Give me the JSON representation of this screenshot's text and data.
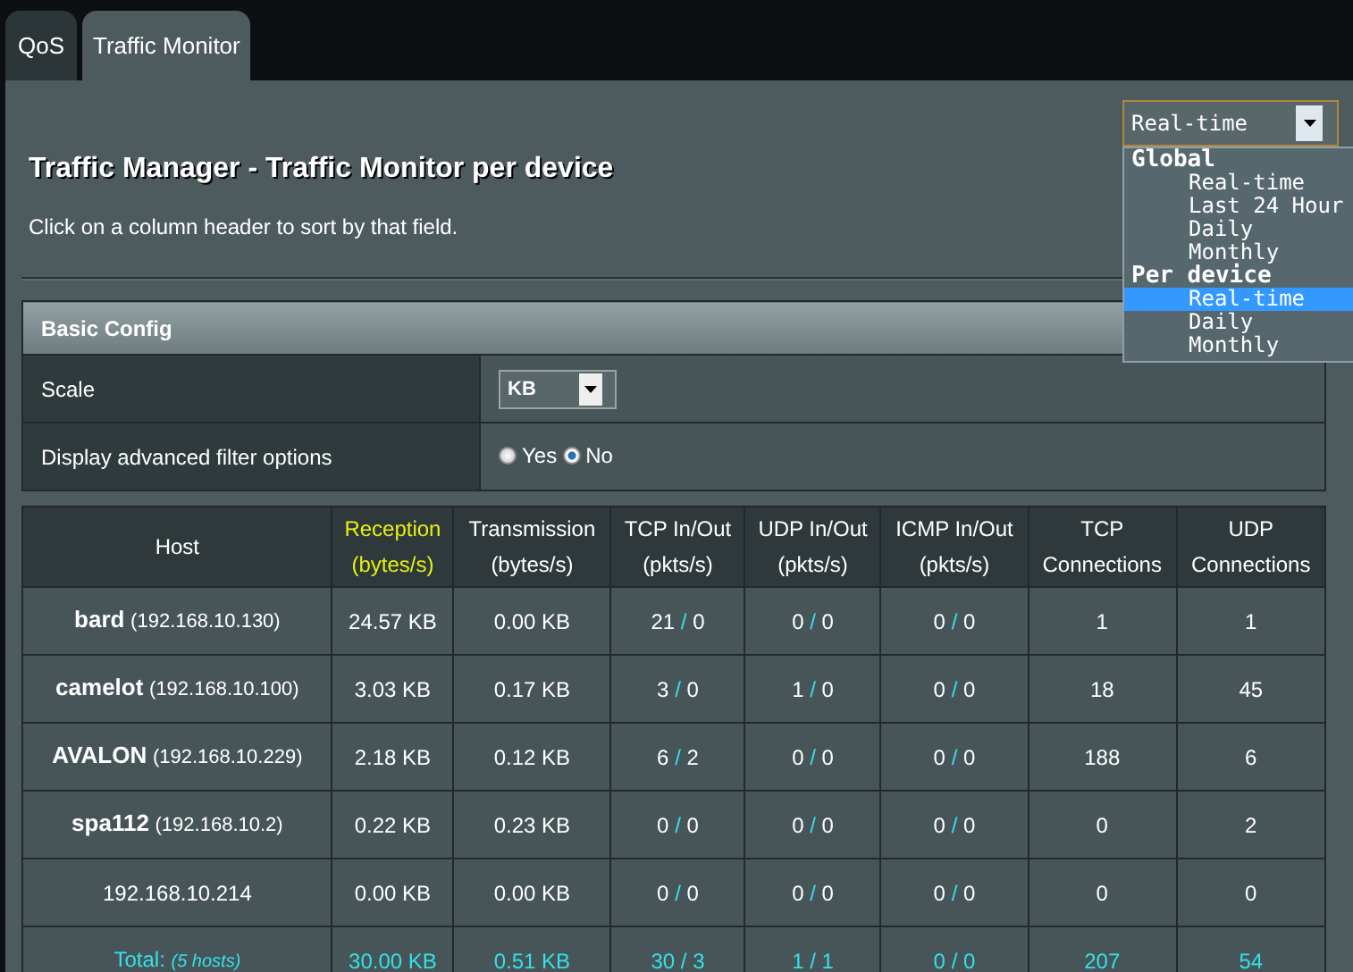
{
  "tabs": [
    {
      "label": "QoS",
      "selected": false
    },
    {
      "label": "Traffic Monitor",
      "selected": true
    }
  ],
  "title": "Traffic Manager - Traffic Monitor per device",
  "hint": "Click on a column header to sort by that field.",
  "view_select": {
    "value": "Real-time",
    "expanded": true,
    "groups": [
      {
        "label": "Global",
        "options": [
          {
            "label": "Real-time",
            "selected": false
          },
          {
            "label": "Last 24 Hour",
            "selected": false
          },
          {
            "label": "Daily",
            "selected": false
          },
          {
            "label": "Monthly",
            "selected": false
          }
        ]
      },
      {
        "label": "Per device",
        "options": [
          {
            "label": "Real-time",
            "selected": true
          },
          {
            "label": "Daily",
            "selected": false
          },
          {
            "label": "Monthly",
            "selected": false
          }
        ]
      }
    ]
  },
  "basic_config": {
    "title": "Basic Config",
    "scale": {
      "label": "Scale",
      "value": "KB"
    },
    "advanced_filter": {
      "label": "Display advanced filter options",
      "options": [
        {
          "label": "Yes",
          "selected": false
        },
        {
          "label": "No",
          "selected": true
        }
      ]
    }
  },
  "table": {
    "columns": [
      {
        "label": "Host",
        "selected": false
      },
      {
        "label": "Reception",
        "unit": "(bytes/s)",
        "selected": true
      },
      {
        "label": "Transmission",
        "unit": "(bytes/s)",
        "selected": false
      },
      {
        "label": "TCP In/Out",
        "unit": "(pkts/s)",
        "selected": false
      },
      {
        "label": "UDP In/Out",
        "unit": "(pkts/s)",
        "selected": false
      },
      {
        "label": "ICMP In/Out",
        "unit": "(pkts/s)",
        "selected": false
      },
      {
        "label": "TCP",
        "unit": "Connections",
        "selected": false
      },
      {
        "label": "UDP",
        "unit": "Connections",
        "selected": false
      }
    ],
    "rows": [
      {
        "host": {
          "name": "bard",
          "ip": "(192.168.10.130)"
        },
        "reception": "24.57 KB",
        "transmission": "0.00 KB",
        "tcp": [
          "21",
          "/",
          "0"
        ],
        "udp": [
          "0",
          "/",
          "0"
        ],
        "icmp": [
          "0",
          "/",
          "0"
        ],
        "tcp_connections": "1",
        "udp_connections": "1"
      },
      {
        "host": {
          "name": "camelot",
          "ip": "(192.168.10.100)"
        },
        "reception": "3.03 KB",
        "transmission": "0.17 KB",
        "tcp": [
          "3",
          "/",
          "0"
        ],
        "udp": [
          "1",
          "/",
          "0"
        ],
        "icmp": [
          "0",
          "/",
          "0"
        ],
        "tcp_connections": "18",
        "udp_connections": "45"
      },
      {
        "host": {
          "name": "AVALON",
          "ip": "(192.168.10.229)"
        },
        "reception": "2.18 KB",
        "transmission": "0.12 KB",
        "tcp": [
          "6",
          "/",
          "2"
        ],
        "udp": [
          "0",
          "/",
          "0"
        ],
        "icmp": [
          "0",
          "/",
          "0"
        ],
        "tcp_connections": "188",
        "udp_connections": "6"
      },
      {
        "host": {
          "name": "spa112",
          "ip": "(192.168.10.2)"
        },
        "reception": "0.22 KB",
        "transmission": "0.23 KB",
        "tcp": [
          "0",
          "/",
          "0"
        ],
        "udp": [
          "0",
          "/",
          "0"
        ],
        "icmp": [
          "0",
          "/",
          "0"
        ],
        "tcp_connections": "0",
        "udp_connections": "2"
      },
      {
        "host": {
          "ip": "192.168.10.214"
        },
        "reception": "0.00 KB",
        "transmission": "0.00 KB",
        "tcp": [
          "0",
          "/",
          "0"
        ],
        "udp": [
          "0",
          "/",
          "0"
        ],
        "icmp": [
          "0",
          "/",
          "0"
        ],
        "tcp_connections": "0",
        "udp_connections": "0"
      }
    ],
    "total": {
      "label": "Total:",
      "hosts": "(5 hosts)",
      "reception": "30.00 KB",
      "transmission": "0.51 KB",
      "tcp": [
        "30",
        "/",
        "3"
      ],
      "udp": [
        "1",
        "/",
        "1"
      ],
      "icmp": [
        "0",
        "/",
        "0"
      ],
      "tcp_connections": "207",
      "udp_connections": "54"
    }
  }
}
